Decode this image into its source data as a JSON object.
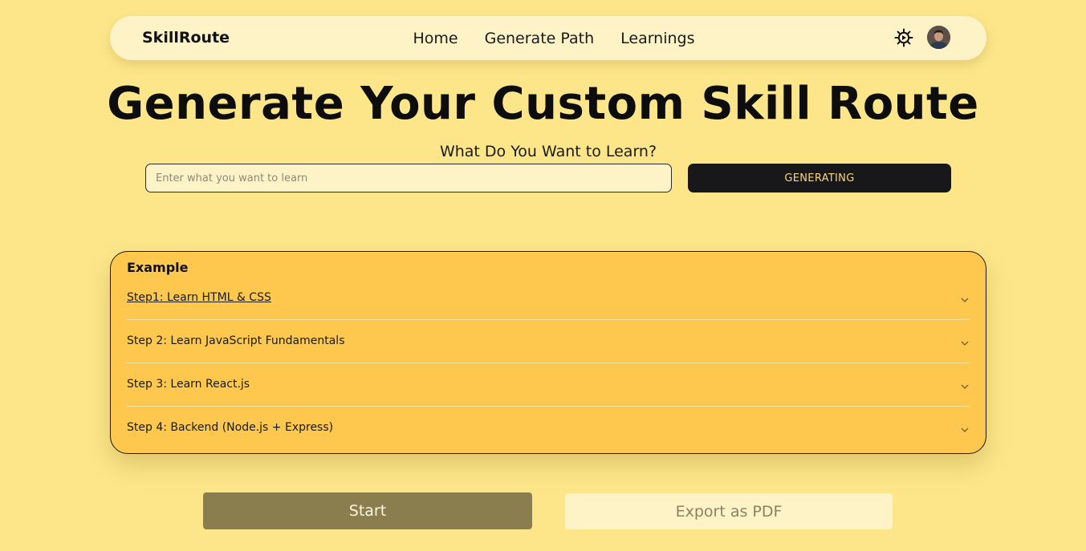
{
  "brand": "SkillRoute",
  "nav": {
    "links": [
      "Home",
      "Generate Path",
      "Learnings"
    ],
    "settings_icon": "gear-icon",
    "profile_icon": "avatar"
  },
  "hero": {
    "title": "Generate Your Custom Skill Route",
    "subtitle": "What Do You Want to Learn?"
  },
  "form": {
    "input_value": "",
    "input_placeholder": "Enter what you want to learn",
    "generate_label": "GENERATING"
  },
  "example": {
    "title": "Example",
    "steps": [
      "Step1: Learn HTML & CSS",
      "Step 2: Learn JavaScript Fundamentals",
      "Step 3: Learn React.js",
      "Step 4: Backend (Node.js + Express)"
    ],
    "chevron_icon": "chevron-down-icon"
  },
  "actions": {
    "start_label": "Start",
    "export_label": "Export as PDF"
  },
  "colors": {
    "background": "#fde68a",
    "navbar": "#fef3c7",
    "card": "#fec84f",
    "dark_button": "#18181a",
    "start_button": "#8b7e4e"
  }
}
